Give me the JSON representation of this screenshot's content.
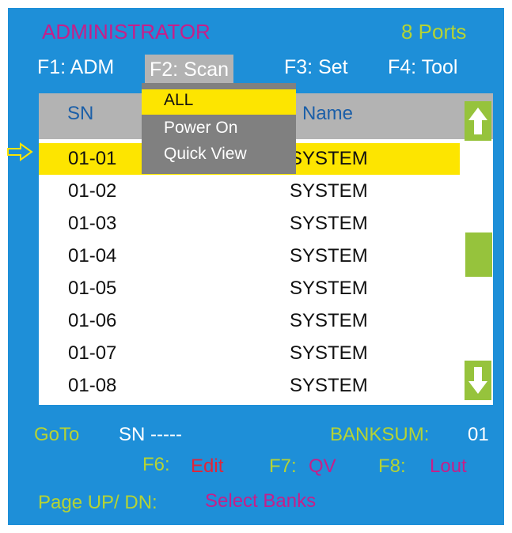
{
  "header": {
    "title": "ADMINISTRATOR",
    "ports": "8 Ports"
  },
  "menu": [
    {
      "key": "F1: ADM"
    },
    {
      "key": "F2: Scan"
    },
    {
      "key": "F3: Set"
    },
    {
      "key": "F4: Tool"
    }
  ],
  "dropdown": {
    "items": [
      "ALL",
      "Power On",
      "Quick View"
    ],
    "selected": "ALL"
  },
  "table": {
    "columns": {
      "sn": "SN",
      "name": "Name"
    },
    "rows": [
      {
        "sn": "01-01",
        "name": "SYSTEM"
      },
      {
        "sn": "01-02",
        "name": "SYSTEM"
      },
      {
        "sn": "01-03",
        "name": "SYSTEM"
      },
      {
        "sn": "01-04",
        "name": "SYSTEM"
      },
      {
        "sn": "01-05",
        "name": "SYSTEM"
      },
      {
        "sn": "01-06",
        "name": "SYSTEM"
      },
      {
        "sn": "01-07",
        "name": "SYSTEM"
      },
      {
        "sn": "01-08",
        "name": "SYSTEM"
      }
    ],
    "selected_row": "01-01"
  },
  "footer": {
    "goto_label": "GoTo",
    "sn_label": "SN -----",
    "banksum_label": "BANKSUM:",
    "banksum_value": "01",
    "f6_key": "F6:",
    "f6_action": "Edit",
    "f7_key": "F7:",
    "f7_action": "QV",
    "f8_key": "F8:",
    "f8_action": "Lout",
    "page_label": "Page UP/ DN:",
    "page_action": "Select Banks"
  },
  "icons": {
    "pointer": "arrow-right-outline-icon",
    "scroll_up": "arrow-up-icon",
    "scroll_down": "arrow-down-icon"
  },
  "colors": {
    "background": "#1e8fd8",
    "title": "#c61f8a",
    "accent_lime": "#b5d334",
    "highlight": "#fde500",
    "action_red": "#e0253a",
    "menu_gray": "#b3b3b3",
    "dropdown_gray": "#808080"
  }
}
